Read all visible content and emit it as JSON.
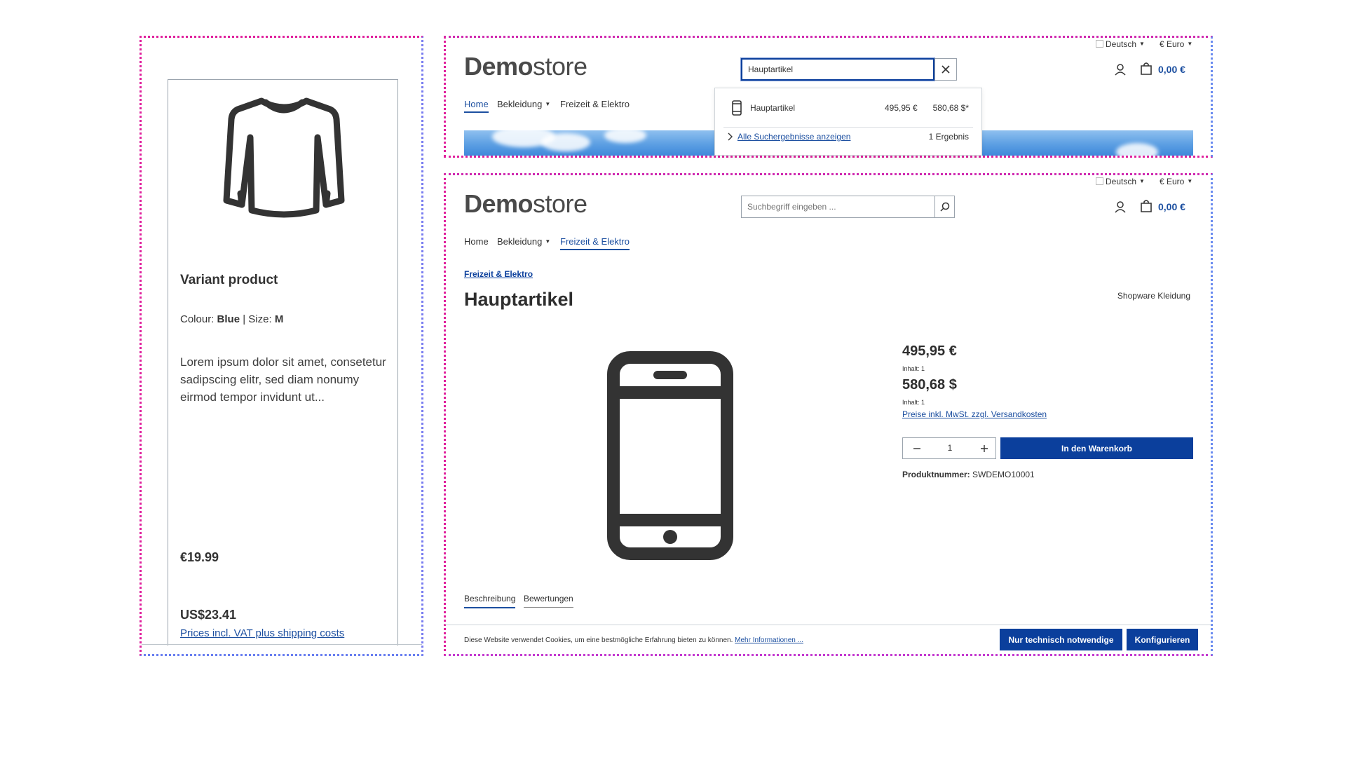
{
  "left_card": {
    "title": "Variant product",
    "variant_prefix": "Colour:",
    "variant_colour": "Blue",
    "variant_sep": " | Size:",
    "variant_size": "M",
    "description": "Lorem ipsum dolor sit amet, consetetur sadipscing elitr, sed diam nonumy eirmod tempor invidunt ut...",
    "price_primary": "€19.99",
    "price_secondary": "US$23.41",
    "tax_link": "Prices incl. VAT plus shipping costs",
    "image_icon": "shirt-icon"
  },
  "store": {
    "logo_bold": "Demo",
    "logo_light": "store",
    "language": "Deutsch",
    "currency": "€ Euro",
    "cart_total": "0,00 €",
    "nav": {
      "home": "Home",
      "clothing": "Bekleidung",
      "leisure": "Freizeit & Elektro"
    }
  },
  "search_view": {
    "query": "Hauptartikel",
    "suggestion": {
      "name": "Hauptartikel",
      "price_eur": "495,95 €",
      "price_usd": "580,68 $*"
    },
    "all_results_link": "Alle Suchergebnisse anzeigen",
    "result_count": "1 Ergebnis"
  },
  "product_view": {
    "search_placeholder": "Suchbegriff eingeben ...",
    "breadcrumb": "Freizeit & Elektro",
    "title": "Hauptartikel",
    "manufacturer": "Shopware Kleidung",
    "price_eur": "495,95 €",
    "content_eur": "Inhalt: 1",
    "price_usd": "580,68 $",
    "content_usd": "Inhalt: 1",
    "tax_link": "Preise inkl. MwSt. zzgl. Versandkosten",
    "quantity": "1",
    "add_to_cart": "In den Warenkorb",
    "product_number_label": "Produktnummer:",
    "product_number": "SWDEMO10001",
    "tabs": {
      "description": "Beschreibung",
      "reviews": "Bewertungen"
    },
    "cookie_text": "Diese Website verwendet Cookies, um eine bestmögliche Erfahrung bieten zu können.",
    "cookie_more": "Mehr Informationen ...",
    "cookie_necessary": "Nur technisch notwendige",
    "cookie_configure": "Konfigurieren"
  },
  "colors": {
    "accent": "#0b3f9c",
    "link": "#1c4fa0",
    "frame_pink": "#e0219d",
    "frame_blue": "#6b8cf0"
  }
}
